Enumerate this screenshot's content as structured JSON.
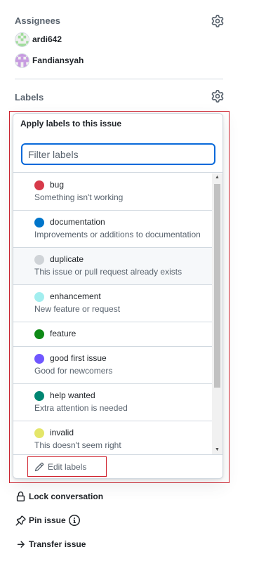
{
  "assignees": {
    "heading": "Assignees",
    "people": [
      {
        "name": "ardi642"
      },
      {
        "name": "Fandiansyah"
      }
    ]
  },
  "labels": {
    "heading": "Labels"
  },
  "label_menu": {
    "title": "Apply labels to this issue",
    "filter_placeholder": "Filter labels",
    "filter_value": "",
    "items": [
      {
        "name": "bug",
        "description": "Something isn't working",
        "color": "#d73a4a"
      },
      {
        "name": "documentation",
        "description": "Improvements or additions to documentation",
        "color": "#0075ca"
      },
      {
        "name": "duplicate",
        "description": "This issue or pull request already exists",
        "color": "#cfd3d7"
      },
      {
        "name": "enhancement",
        "description": "New feature or request",
        "color": "#a2eeef"
      },
      {
        "name": "feature",
        "description": "",
        "color": "#0e8a16"
      },
      {
        "name": "good first issue",
        "description": "Good for newcomers",
        "color": "#7057ff"
      },
      {
        "name": "help wanted",
        "description": "Extra attention is needed",
        "color": "#008672"
      },
      {
        "name": "invalid",
        "description": "This doesn't seem right",
        "color": "#e4e669"
      }
    ],
    "edit_label": "Edit labels"
  },
  "actions": {
    "lock": "Lock conversation",
    "pin": "Pin issue",
    "transfer": "Transfer issue"
  },
  "colors": {
    "accent_focus": "#0969da",
    "highlight_box": "#cf222e",
    "muted_text": "#59636e",
    "border": "#d1d9e0"
  },
  "icons": {
    "assignees_settings": "gear-icon",
    "labels_settings": "gear-icon",
    "edit": "pencil-icon",
    "lock": "lock-icon",
    "pin": "pin-icon",
    "info": "info-icon",
    "transfer": "arrow-right-icon"
  }
}
